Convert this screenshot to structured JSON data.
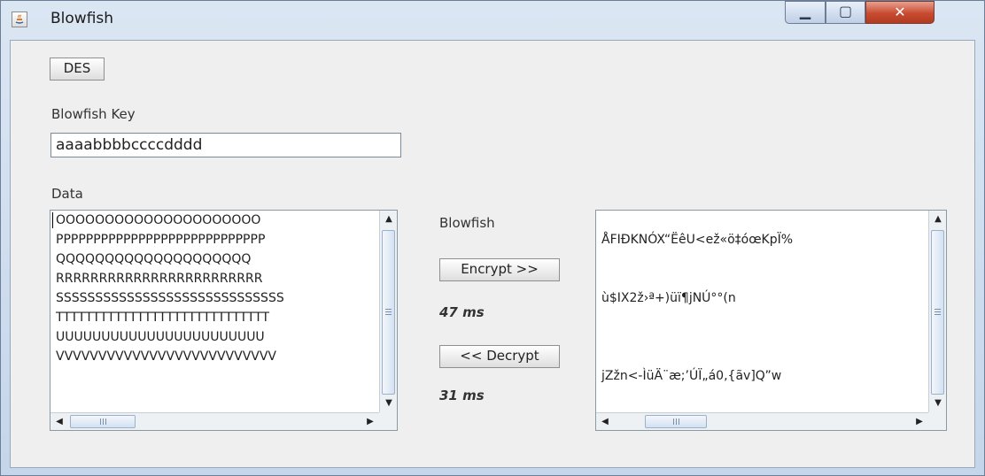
{
  "window": {
    "title": "Blowfish",
    "colors": {
      "close": "#c84b30",
      "titlebar": "#c5d6ea",
      "panel": "#efefef"
    }
  },
  "controls": {
    "minimize": "minimize-icon",
    "maximize": "maximize-icon",
    "close": "close-icon"
  },
  "toolbar": {
    "des_label": "DES"
  },
  "key": {
    "label": "Blowfish Key",
    "value": "aaaabbbbccccdddd"
  },
  "data": {
    "label": "Data",
    "lines": [
      "OOOOOOOOOOOOOOOOOOOOO",
      "PPPPPPPPPPPPPPPPPPPPPPPPPPPP",
      "QQQQQQQQQQQQQQQQQQQQ",
      "RRRRRRRRRRRRRRRRRRRRRRRR",
      "SSSSSSSSSSSSSSSSSSSSSSSSSSSSS",
      "TTTTTTTTTTTTTTTTTTTTTTTTTTTTT",
      "UUUUUUUUUUUUUUUUUUUUUUU",
      "VVVVVVVVVVVVVVVVVVVVVVVVVV"
    ]
  },
  "actions": {
    "algorithm_label": "Blowfish",
    "encrypt_label": "Encrypt >>",
    "encrypt_time": "47 ms",
    "decrypt_label": "<< Decrypt",
    "decrypt_time": "31 ms"
  },
  "output": {
    "lines": [
      "",
      "ÅFIÐKNÓX“ËêU<ež«ö‡óœKpÏ%",
      "",
      "",
      "ù$IX2ž›ª+)üï¶jNÚ°°(n",
      "",
      "",
      "",
      "jZžn<-ÌüÄ¨æ;’ÚÏ„á0,{ãv]Q”w"
    ]
  }
}
